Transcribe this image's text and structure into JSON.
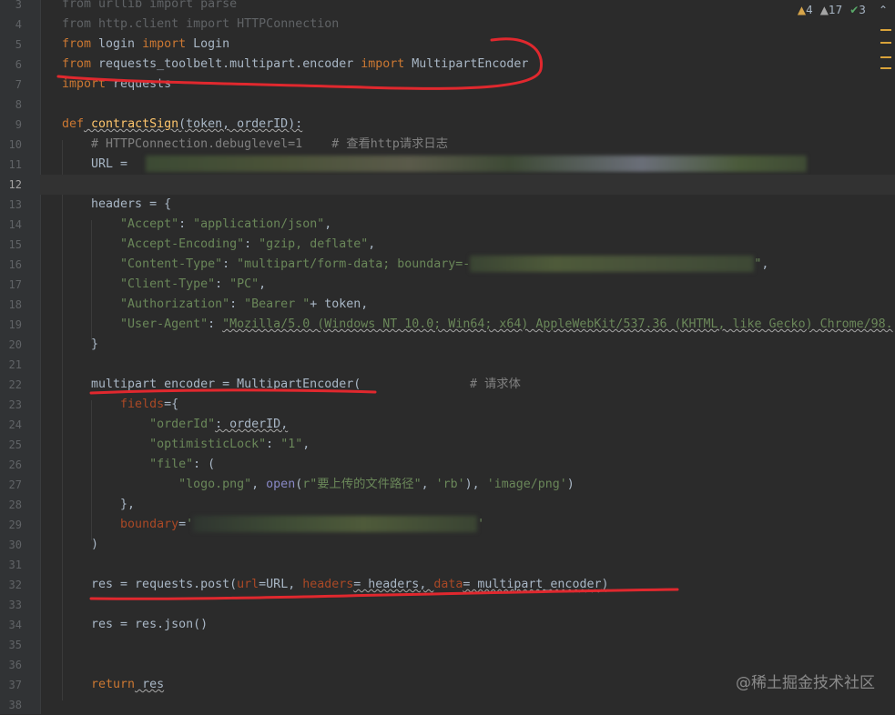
{
  "gutter": {
    "line_numbers": [
      "3",
      "4",
      "5",
      "6",
      "7",
      "8",
      "9",
      "10",
      "11",
      "12",
      "13",
      "14",
      "15",
      "16",
      "17",
      "18",
      "19",
      "20",
      "21",
      "22",
      "23",
      "24",
      "25",
      "26",
      "27",
      "28",
      "29",
      "30",
      "31",
      "32",
      "33",
      "34",
      "35",
      "36",
      "37",
      "38"
    ],
    "current_line": "12"
  },
  "code": {
    "l3_kw1": "from",
    "l3_mod": " urllib ",
    "l3_kw2": "import",
    "l3_name": " parse",
    "l4_kw1": "from",
    "l4_mod": " http.client ",
    "l4_kw2": "import",
    "l4_name": " HTTPConnection",
    "l5_kw1": "from",
    "l5_mod": " login ",
    "l5_kw2": "import",
    "l5_name": " Login",
    "l6_kw1": "from",
    "l6_mod": " requests_toolbelt.multipart.encoder ",
    "l6_kw2": "import",
    "l6_name": " MultipartEncoder",
    "l7_kw": "import",
    "l7_name": " requests",
    "l9_kw": "def",
    "l9_fn": " contractSign",
    "l9_sig": "(token, orderID):",
    "l10_comment": "    # HTTPConnection.debuglevel=1    # 查看http请求日志",
    "l11_text": "    URL = ",
    "l13_text": "    headers = {",
    "l14_key": "\"Accept\"",
    "l14_val": "\"application/json\"",
    "l15_key": "\"Accept-Encoding\"",
    "l15_val": "\"gzip, deflate\"",
    "l16_key": "\"Content-Type\"",
    "l16_val": "\"multipart/form-data; boundary=-",
    "l16_end": "\"",
    "l17_key": "\"Client-Type\"",
    "l17_val": "\"PC\"",
    "l18_key": "\"Authorization\"",
    "l18_val": "\"Bearer \"",
    "l18_tail": "+ token,",
    "l19_key": "\"User-Agent\"",
    "l19_val": "\"Mozilla/5.0 (Windows NT 10.0; Win64; x64) AppleWebKit/537.36 (KHTML, like Gecko) Chrome/98.",
    "l20_text": "    }",
    "l22_text": "    multipart_encoder = MultipartEncoder(",
    "l22_comment": "# 请求体",
    "l23_param": "fields",
    "l23_rest": "={",
    "l24_key": "\"orderId\"",
    "l24_rest": ": orderID,",
    "l25_key": "\"optimisticLock\"",
    "l25_val": "\"1\"",
    "l26_key": "\"file\"",
    "l26_rest": ": (",
    "l27_s1": "\"logo.png\"",
    "l27_open": "open",
    "l27_s2": "r\"要上传的文件路径\"",
    "l27_s3": "'rb'",
    "l27_s4": "'image/png'",
    "l28_text": "        },",
    "l29_param": "boundary",
    "l29_eq": "=",
    "l29_q1": "'",
    "l29_q2": "'",
    "l30_text": "    )",
    "l32_a": "    res = requests.post(",
    "l32_p1": "url",
    "l32_b": "=URL, ",
    "l32_p2": "headers",
    "l32_c": "= headers, ",
    "l32_p3": "data",
    "l32_d": "= multipart_encoder)",
    "l34_text": "    res = res.json()",
    "l37_kw": "return",
    "l37_rest": " res"
  },
  "inspections": {
    "warnings": "4",
    "weak_warnings": "17",
    "ok": "3"
  },
  "watermark": "@稀土掘金技术社区",
  "colors": {
    "background": "#2b2b2b",
    "keyword": "#cc7832",
    "function": "#ffc66d",
    "string": "#6a8759",
    "annotation": "#e0282e"
  }
}
